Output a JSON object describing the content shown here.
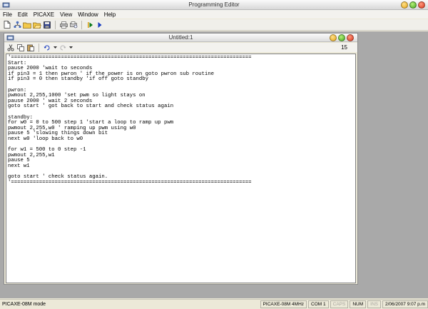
{
  "window": {
    "title": "Programming Editor"
  },
  "menu": [
    "File",
    "Edit",
    "PICAXE",
    "View",
    "Window",
    "Help"
  ],
  "toolbar": {
    "icons": [
      "new-file-icon",
      "program-icon",
      "open-folder-icon",
      "open-icon",
      "save-icon",
      "print-icon",
      "print-preview-icon",
      "step-icon",
      "run-icon"
    ]
  },
  "document": {
    "title": "Untitled:1",
    "line_count": "15",
    "code": "'=============================================================================\nStart:\npause 2000 'wait to seconds\nif pin3 = 1 then pwron ' if the power is on goto pwron sub routine\nif pin3 = 0 then standby 'if off goto standby\n\npwron:\npwmout 2,255,1000 'set pwm so light stays on\npause 2000 ' wait 2 seconds\ngoto start ' got back to start and check status again\n\nstandby:\nfor w0 = 0 to 500 step 1 'start a loop to ramp up pwm\npwmout 2,255,w0 ' ramping up pwm using w0\npause 5 'slowing things down bit\nnext w0 'loop back to w0\n\nfor w1 = 500 to 0 step -1\npwmout 2,255,w1\npause 5\nnext w1\n\ngoto start ' check status again.\n'============================================================================="
  },
  "status": {
    "mode": "PICAXE-08M mode",
    "chip": "PICAXE-08M 4MHz",
    "port": "COM 1",
    "caps": "CAPS",
    "num": "NUM",
    "ins": "INS",
    "datetime": "2/06/2007  9:07 p.m"
  }
}
